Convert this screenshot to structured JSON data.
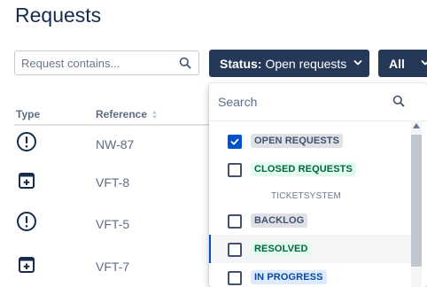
{
  "page": {
    "title": "Requests"
  },
  "filters": {
    "search_placeholder": "Request contains...",
    "status_key": "Status:",
    "status_value": "Open requests",
    "scope_label": "All"
  },
  "table": {
    "headers": {
      "type": "Type",
      "reference": "Reference"
    },
    "rows": [
      {
        "type_icon": "alert-circle-icon",
        "reference": "NW-87"
      },
      {
        "type_icon": "form-add-icon",
        "reference": "VFT-8"
      },
      {
        "type_icon": "alert-circle-icon",
        "reference": "VFT-5"
      },
      {
        "type_icon": "form-add-icon",
        "reference": "VFT-7"
      }
    ]
  },
  "status_dropdown": {
    "search_placeholder": "Search",
    "options": [
      {
        "label": "OPEN REQUESTS",
        "checked": true,
        "bg": "#dfe1e6",
        "fg": "#42526e"
      },
      {
        "label": "CLOSED REQUESTS",
        "checked": false,
        "bg": "#e3fcef",
        "fg": "#006644"
      },
      {
        "label": "BACKLOG",
        "checked": false,
        "bg": "#dfe1e6",
        "fg": "#42526e"
      },
      {
        "label": "RESOLVED",
        "checked": false,
        "bg": "#e3fcef",
        "fg": "#006644"
      },
      {
        "label": "IN PROGRESS",
        "checked": false,
        "bg": "#deebff",
        "fg": "#0747a6"
      }
    ],
    "group_label": "TICKETSYSTEM"
  },
  "colors": {
    "primary_button": "#253858",
    "accent": "#0052cc"
  }
}
